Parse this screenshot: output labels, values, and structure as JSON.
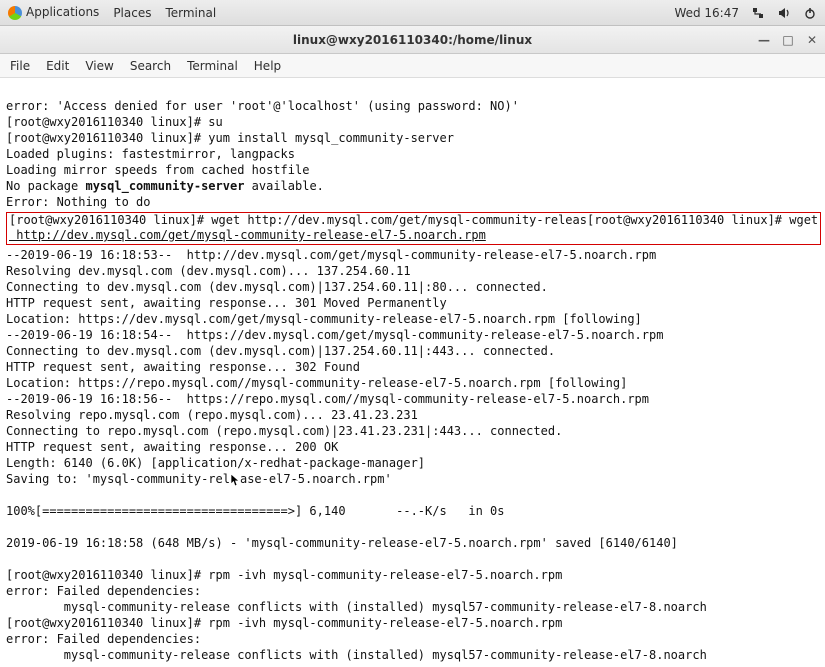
{
  "topbar": {
    "app": "Applications",
    "places": "Places",
    "term": "Terminal",
    "clock": "Wed 16:47"
  },
  "title": "linux@wxy2016110340:/home/linux",
  "menubar": {
    "file": "File",
    "edit": "Edit",
    "view": "View",
    "search": "Search",
    "terminal": "Terminal",
    "help": "Help"
  },
  "term": {
    "l1": "error: 'Access denied for user 'root'@'localhost' (using password: NO)'",
    "l2": "[root@wxy2016110340 linux]# su",
    "l3": "[root@wxy2016110340 linux]# yum install mysql_community-server",
    "l4": "Loaded plugins: fastestmirror, langpacks",
    "l5": "Loading mirror speeds from cached hostfile",
    "l6a": "No package ",
    "l6b": "mysql_community-server",
    "l6c": " available.",
    "l7": "Error: Nothing to do",
    "hl1": "[root@wxy2016110340 linux]# wget http://dev.mysql.com/get/mysql-community-releas[root@wxy2016110340 linux]# wget",
    "hl2": " http://dev.mysql.com/get/mysql-community-release-el7-5.noarch.rpm",
    "l8": "--2019-06-19 16:18:53--  http://dev.mysql.com/get/mysql-community-release-el7-5.noarch.rpm",
    "l9": "Resolving dev.mysql.com (dev.mysql.com)... 137.254.60.11",
    "l10": "Connecting to dev.mysql.com (dev.mysql.com)|137.254.60.11|:80... connected.",
    "l11": "HTTP request sent, awaiting response... 301 Moved Permanently",
    "l12": "Location: https://dev.mysql.com/get/mysql-community-release-el7-5.noarch.rpm [following]",
    "l13": "--2019-06-19 16:18:54--  https://dev.mysql.com/get/mysql-community-release-el7-5.noarch.rpm",
    "l14": "Connecting to dev.mysql.com (dev.mysql.com)|137.254.60.11|:443... connected.",
    "l15": "HTTP request sent, awaiting response... 302 Found",
    "l16": "Location: https://repo.mysql.com//mysql-community-release-el7-5.noarch.rpm [following]",
    "l17": "--2019-06-19 16:18:56--  https://repo.mysql.com//mysql-community-release-el7-5.noarch.rpm",
    "l18": "Resolving repo.mysql.com (repo.mysql.com)... 23.41.23.231",
    "l19": "Connecting to repo.mysql.com (repo.mysql.com)|23.41.23.231|:443... connected.",
    "l20": "HTTP request sent, awaiting response... 200 OK",
    "l21": "Length: 6140 (6.0K) [application/x-redhat-package-manager]",
    "l22a": "Saving to: 'mysql-community-rel",
    "l22b": "ase-el7-5.noarch.rpm'",
    "lblank": "",
    "l23": "100%[==================================>] 6,140       --.-K/s   in 0s",
    "l24": "2019-06-19 16:18:58 (648 MB/s) - 'mysql-community-release-el7-5.noarch.rpm' saved [6140/6140]",
    "l25": "[root@wxy2016110340 linux]# rpm -ivh mysql-community-release-el7-5.noarch.rpm",
    "l26": "error: Failed dependencies:",
    "l27": "        mysql-community-release conflicts with (installed) mysql57-community-release-el7-8.noarch",
    "l28": "[root@wxy2016110340 linux]# rpm -ivh mysql-community-release-el7-5.noarch.rpm",
    "l29": "error: Failed dependencies:",
    "l30": "        mysql-community-release conflicts with (installed) mysql57-community-release-el7-8.noarch"
  },
  "icons": {
    "min": "—",
    "max": "□",
    "close": "✕"
  }
}
